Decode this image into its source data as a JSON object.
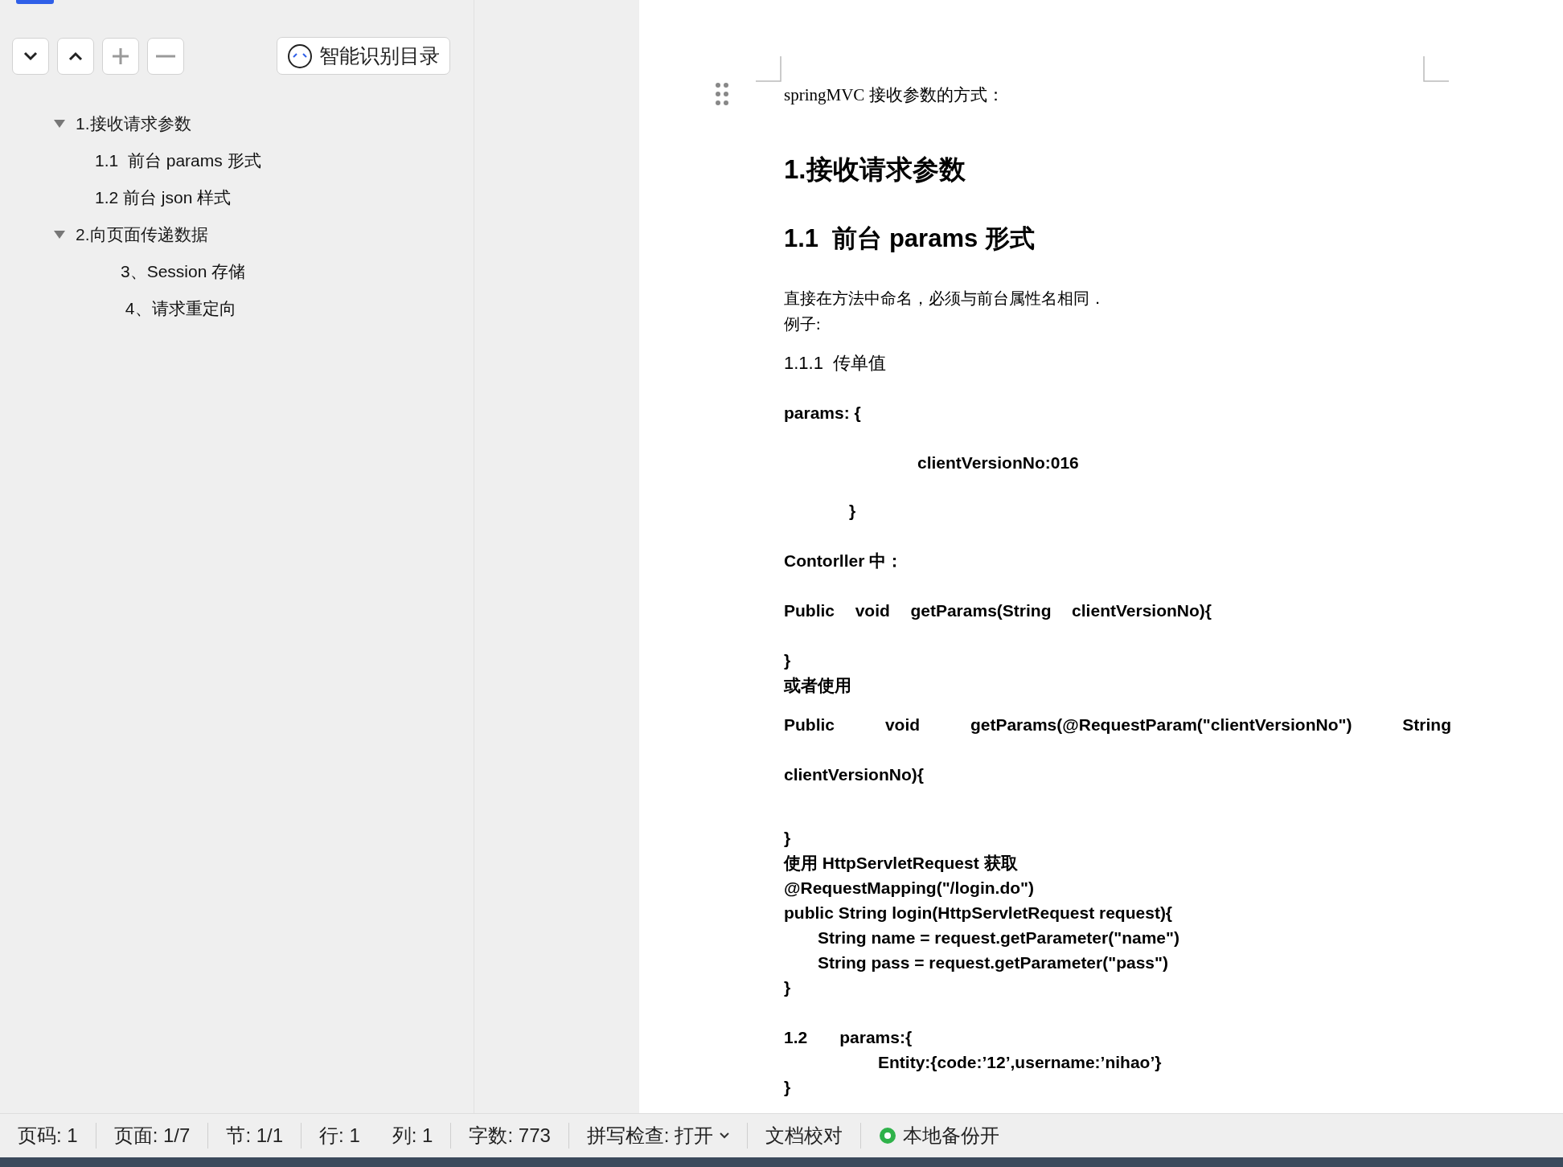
{
  "outline_toolbar": {
    "buttons": [
      {
        "kind": "down"
      },
      {
        "kind": "up"
      },
      {
        "kind": "add",
        "disabled": true
      },
      {
        "kind": "remove",
        "disabled": true
      }
    ],
    "smart_button": {
      "label": "智能识别目录"
    }
  },
  "outline": [
    {
      "label": "1.接收请求参数",
      "expanded": true,
      "children": [
        {
          "label": "1.1  前台 params 形式"
        },
        {
          "label": "1.2 前台 json 样式"
        }
      ]
    },
    {
      "label": "2.向页面传递数据",
      "expanded": true,
      "children": [
        {
          "label": "3、Session 存储"
        },
        {
          "label": " 4、请求重定向"
        }
      ]
    }
  ],
  "document": {
    "lines": [
      {
        "kind": "lead",
        "text": "springMVC 接收参数的方式："
      },
      {
        "kind": "h1",
        "text": "1.接收请求参数"
      },
      {
        "kind": "h2",
        "text": "1.1  前台 params 形式"
      },
      {
        "kind": "body",
        "text": "直接在方法中命名，必须与前台属性名相同．"
      },
      {
        "kind": "body-tight",
        "text": "例子:"
      },
      {
        "kind": "h3",
        "text": "1.1.1  传单值"
      },
      {
        "kind": "code-gap",
        "text": "params: {"
      },
      {
        "kind": "code-deep",
        "text": "clientVersionNo:016"
      },
      {
        "kind": "code-mid",
        "text": "}"
      },
      {
        "kind": "code-gap",
        "text": "Contorller 中："
      },
      {
        "kind": "spread-gap",
        "parts": [
          "Public",
          "void",
          "getParams(String",
          "clientVersionNo){"
        ]
      },
      {
        "kind": "code-gap",
        "text": "}"
      },
      {
        "kind": "code",
        "text": "或者使用"
      },
      {
        "kind": "spread-wide",
        "parts": [
          "Public",
          "void",
          "getParams(@RequestParam(\"clientVersionNo\")",
          "String"
        ]
      },
      {
        "kind": "code-gap",
        "text": "clientVersionNo){"
      },
      {
        "kind": "code-biggap",
        "text": "}"
      },
      {
        "kind": "code",
        "text": "使用 HttpServletRequest 获取"
      },
      {
        "kind": "code",
        "text": "@RequestMapping(\"/login.do\")"
      },
      {
        "kind": "code",
        "text": "public String login(HttpServletRequest request){"
      },
      {
        "kind": "code-in",
        "text": "String name = request.getParameter(\"name\")"
      },
      {
        "kind": "code-in",
        "text": "String pass = request.getParameter(\"pass\")"
      },
      {
        "kind": "code",
        "text": "}"
      },
      {
        "kind": "code-head",
        "parts": [
          "1.2",
          "params:{"
        ]
      },
      {
        "kind": "code-in2",
        "text": "Entity:{code:’12’,username:’nihao’}"
      },
      {
        "kind": "code",
        "text": "}"
      }
    ]
  },
  "status_bar": [
    {
      "kind": "text",
      "text": "页码: 1"
    },
    {
      "kind": "text",
      "text": "页面: 1/7"
    },
    {
      "kind": "text",
      "text": "节: 1/1"
    },
    {
      "kind": "pair",
      "parts": [
        "行: 1",
        "列: 1"
      ]
    },
    {
      "kind": "text",
      "text": "字数: 773"
    },
    {
      "kind": "dropdown",
      "text": "拼写检查: 打开"
    },
    {
      "kind": "button",
      "text": "文档校对"
    },
    {
      "kind": "backup",
      "text": "本地备份开",
      "on": true
    }
  ]
}
